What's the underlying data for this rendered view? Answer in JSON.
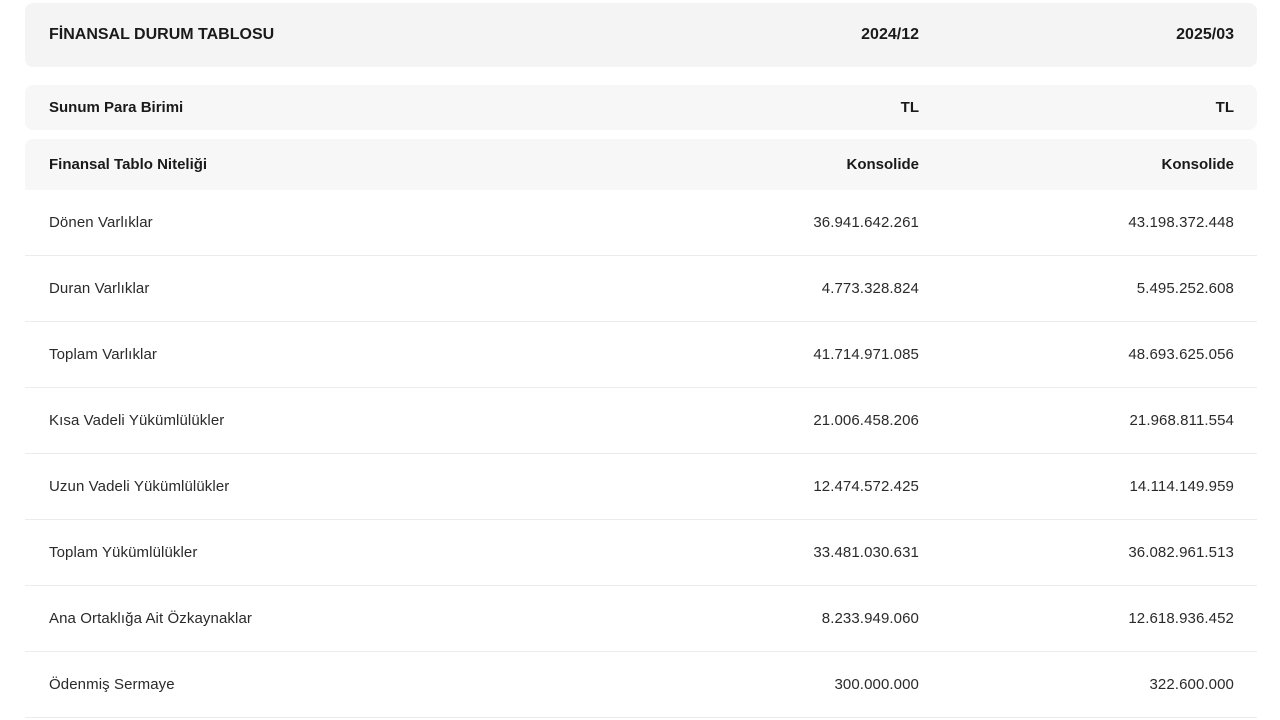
{
  "header": {
    "title": "FİNANSAL DURUM TABLOSU",
    "period_1": "2024/12",
    "period_2": "2025/03"
  },
  "meta_rows": [
    {
      "label": "Sunum Para Birimi",
      "v1": "TL",
      "v2": "TL"
    },
    {
      "label": "Finansal Tablo Niteliği",
      "v1": "Konsolide",
      "v2": "Konsolide"
    }
  ],
  "rows": [
    {
      "label": "Dönen Varlıklar",
      "v1": "36.941.642.261",
      "v2": "43.198.372.448"
    },
    {
      "label": "Duran Varlıklar",
      "v1": "4.773.328.824",
      "v2": "5.495.252.608"
    },
    {
      "label": "Toplam Varlıklar",
      "v1": "41.714.971.085",
      "v2": "48.693.625.056"
    },
    {
      "label": "Kısa Vadeli Yükümlülükler",
      "v1": "21.006.458.206",
      "v2": "21.968.811.554"
    },
    {
      "label": "Uzun Vadeli Yükümlülükler",
      "v1": "12.474.572.425",
      "v2": "14.114.149.959"
    },
    {
      "label": "Toplam Yükümlülükler",
      "v1": "33.481.030.631",
      "v2": "36.082.961.513"
    },
    {
      "label": "Ana Ortaklığa Ait Özkaynaklar",
      "v1": "8.233.949.060",
      "v2": "12.618.936.452"
    },
    {
      "label": "Ödenmiş Sermaye",
      "v1": "300.000.000",
      "v2": "322.600.000"
    }
  ]
}
